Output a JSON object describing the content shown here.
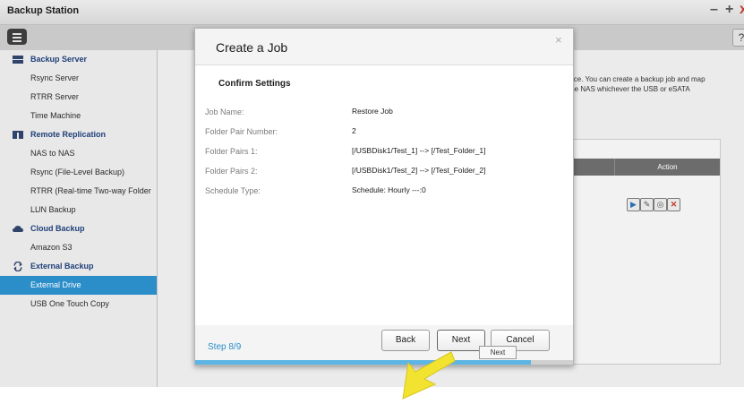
{
  "window": {
    "title": "Backup Station",
    "minimize_glyph": "–",
    "maximize_glyph": "+",
    "close_glyph": "x"
  },
  "toolbar": {
    "help_label": "?"
  },
  "sidebar": {
    "items": [
      {
        "label": "Backup Server",
        "type": "category",
        "icon": "server-icon"
      },
      {
        "label": "Rsync Server",
        "type": "item"
      },
      {
        "label": "RTRR Server",
        "type": "item"
      },
      {
        "label": "Time Machine",
        "type": "item"
      },
      {
        "label": "Remote Replication",
        "type": "category",
        "icon": "replication-icon"
      },
      {
        "label": "NAS to NAS",
        "type": "item"
      },
      {
        "label": "Rsync (File-Level Backup)",
        "type": "item"
      },
      {
        "label": "RTRR (Real-time Two-way Folder ...",
        "type": "item"
      },
      {
        "label": "LUN Backup",
        "type": "item"
      },
      {
        "label": "Cloud Backup",
        "type": "category",
        "icon": "cloud-icon"
      },
      {
        "label": "Amazon S3",
        "type": "item"
      },
      {
        "label": "External Backup",
        "type": "category",
        "icon": "sync-icon"
      },
      {
        "label": "External Drive",
        "type": "item",
        "active": true
      },
      {
        "label": "USB One Touch Copy",
        "type": "item"
      }
    ]
  },
  "main": {
    "description_line1": "vice. You can create a backup job and map",
    "description_line2": "the NAS whichever the USB or eSATA",
    "table": {
      "action_header": "Action"
    }
  },
  "modal": {
    "title": "Create a Job",
    "close_label": "×",
    "section_title": "Confirm Settings",
    "rows": [
      {
        "label": "Job Name:",
        "value": "Restore Job"
      },
      {
        "label": "Folder Pair Number:",
        "value": "2"
      },
      {
        "label": "Folder Pairs 1:",
        "value": "[/USBDisk1/Test_1] --> [/Test_Folder_1]"
      },
      {
        "label": "Folder Pairs 2:",
        "value": "[/USBDisk1/Test_2] --> [/Test_Folder_2]"
      },
      {
        "label": "Schedule Type:",
        "value": "Schedule: Hourly ---:0"
      }
    ],
    "step_label": "Step 8/9",
    "back_label": "Back",
    "next_label": "Next",
    "cancel_label": "Cancel",
    "tooltip": "Next",
    "progress_fraction": 0.889
  },
  "colors": {
    "accent": "#2b8ec9",
    "progress": "#5cb5e4",
    "arrow": "#f2e330"
  }
}
